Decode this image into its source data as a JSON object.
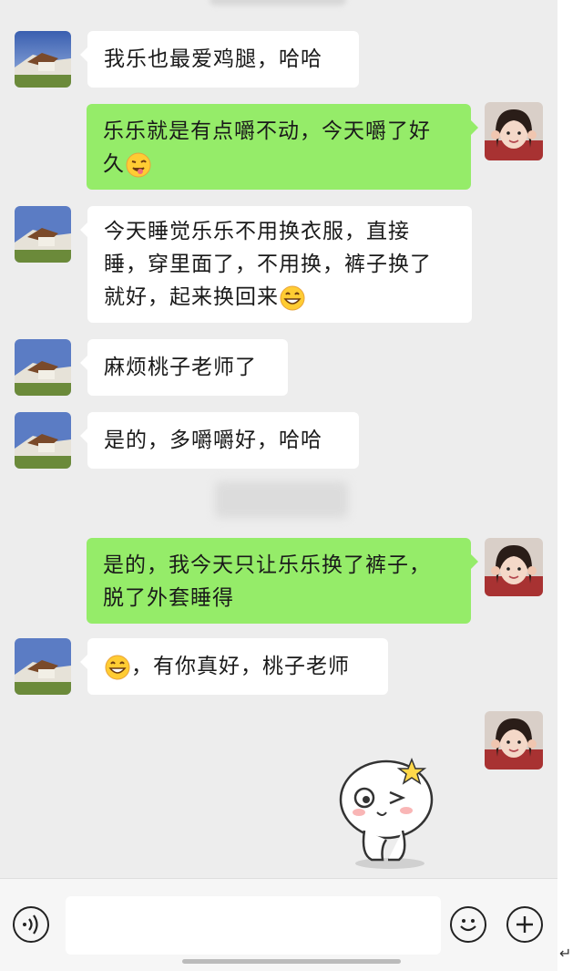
{
  "messages": [
    {
      "sender": "friend",
      "text": "我乐也最爱鸡腿，哈哈"
    },
    {
      "sender": "me",
      "text": "乐乐就是有点嚼不动，今天嚼了好久",
      "emoji": "winking-face-tongue-icon"
    },
    {
      "sender": "friend",
      "text": "今天睡觉乐乐不用换衣服，直接睡，穿里面了，不用换，裤子换了就好，起来换回来",
      "emoji": "grinning-face-icon"
    },
    {
      "sender": "friend",
      "text": "麻烦桃子老师了"
    },
    {
      "sender": "friend",
      "text": "是的，多嚼嚼好，哈哈"
    },
    {
      "sender": "me",
      "text": "是的，我今天只让乐乐换了裤子，脱了外套睡得"
    },
    {
      "sender": "friend",
      "text": "，有你真好，桃子老师",
      "emoji_leading": "grinning-face-icon"
    },
    {
      "sender": "me",
      "type": "sticker",
      "sticker": "winking-bun-sticker"
    }
  ],
  "lines": {
    "m2_l1": "乐乐就是有点嚼不动，今天嚼了好",
    "m2_l2": "久",
    "m3_l1": "今天睡觉乐乐不用换衣服，直接",
    "m3_l2": "睡，穿里面了，不用换，裤子换了",
    "m3_l3": "就好，起来换回来",
    "m6_l1": "是的，我今天只让乐乐换了裤子，",
    "m6_l2": "脱了外套睡得"
  },
  "input_bar": {
    "voice_icon": "voice-icon",
    "emoji_icon": "emoji-icon",
    "plus_icon": "plus-icon",
    "input_value": ""
  },
  "return_mark": "↵",
  "colors": {
    "chat_bg": "#ededed",
    "my_bubble": "#95ec69",
    "friend_bubble": "#ffffff",
    "input_bar_bg": "#f6f6f6"
  }
}
